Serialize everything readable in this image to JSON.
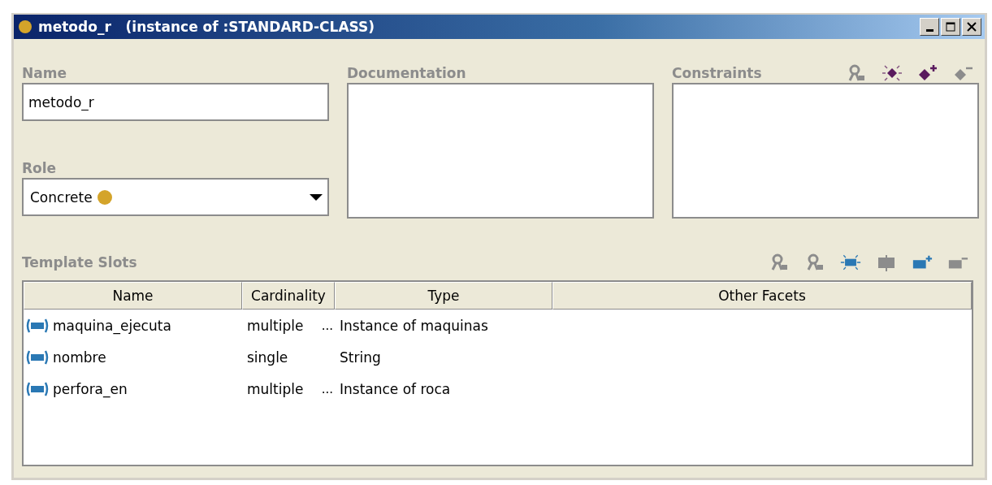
{
  "window": {
    "title_name": "metodo_r",
    "title_type": "(instance of :STANDARD-CLASS)",
    "controls": [
      {
        "kind": "minimize"
      },
      {
        "kind": "maximize"
      },
      {
        "kind": "close"
      }
    ]
  },
  "name": {
    "label": "Name",
    "value": "metodo_r"
  },
  "documentation": {
    "label": "Documentation"
  },
  "constraints": {
    "label": "Constraints",
    "tools": [
      {
        "kind": "view",
        "disabled": true
      },
      {
        "kind": "create",
        "disabled": false
      },
      {
        "kind": "add",
        "disabled": false
      },
      {
        "kind": "remove",
        "disabled": true
      }
    ]
  },
  "role": {
    "label": "Role",
    "value": "Concrete"
  },
  "template_slots": {
    "label": "Template Slots",
    "tools": [
      {
        "kind": "view-class",
        "disabled": true
      },
      {
        "kind": "view-facet",
        "disabled": true
      },
      {
        "kind": "create",
        "disabled": false
      },
      {
        "kind": "override",
        "disabled": true
      },
      {
        "kind": "add",
        "disabled": false
      },
      {
        "kind": "remove",
        "disabled": true
      }
    ],
    "columns": [
      "Name",
      "Cardinality",
      "Type",
      "Other Facets"
    ],
    "rows": [
      {
        "name": "maquina_ejecuta",
        "cardinality": "multiple",
        "more": "...",
        "type": "Instance of maquinas"
      },
      {
        "name": "nombre",
        "cardinality": "single",
        "type": "String"
      },
      {
        "name": "perfora_en",
        "cardinality": "multiple",
        "more": "...",
        "type": "Instance of roca"
      }
    ]
  }
}
